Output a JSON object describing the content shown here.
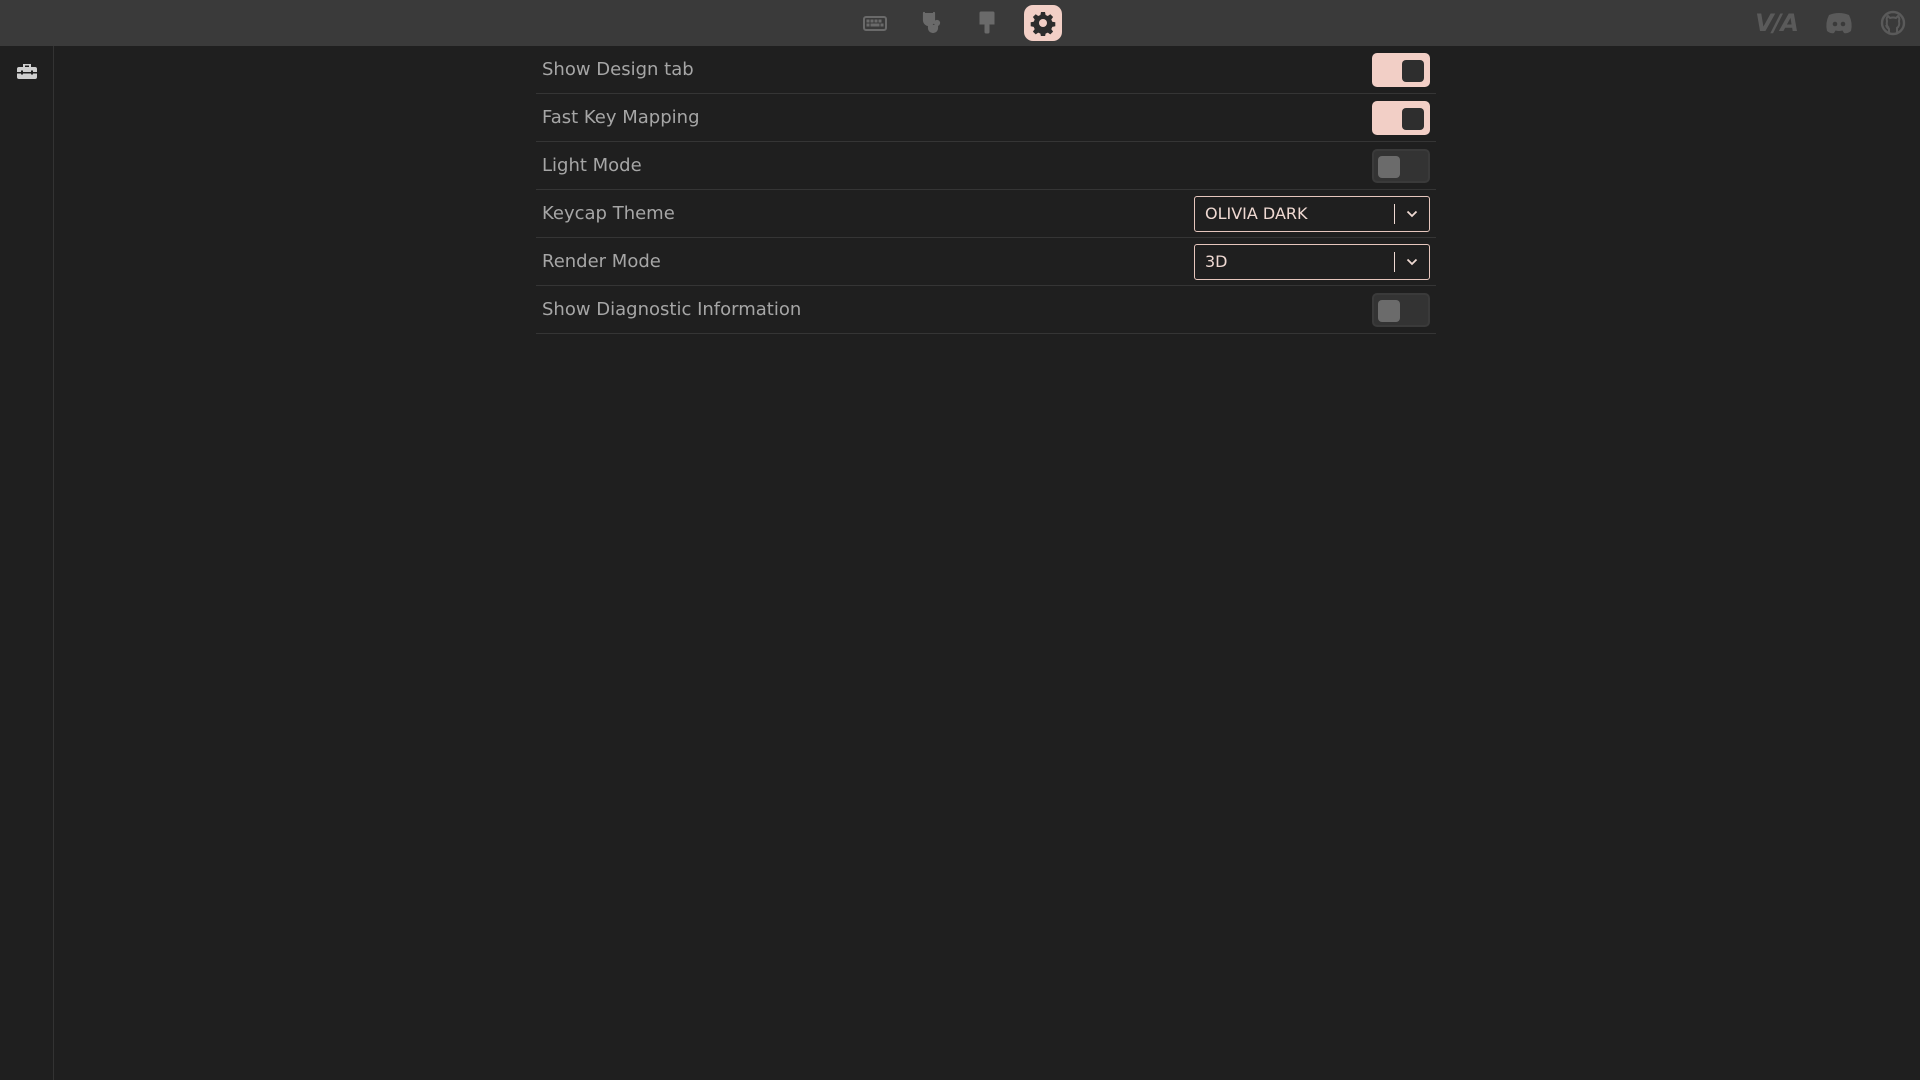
{
  "topbar": {
    "tabs": [
      {
        "icon": "keyboard-icon",
        "active": false
      },
      {
        "icon": "stethoscope-icon",
        "active": false
      },
      {
        "icon": "paintbrush-icon",
        "active": false
      },
      {
        "icon": "gear-icon",
        "active": true
      }
    ],
    "brand": "V/A",
    "right_icons": [
      "via-logo",
      "discord-icon",
      "github-icon"
    ]
  },
  "sidebar": {
    "items": [
      {
        "icon": "toolbox-icon"
      }
    ]
  },
  "settings": {
    "rows": [
      {
        "label": "Show Design tab",
        "control": "toggle",
        "on": true
      },
      {
        "label": "Fast Key Mapping",
        "control": "toggle",
        "on": true
      },
      {
        "label": "Light Mode",
        "control": "toggle",
        "on": false
      },
      {
        "label": "Keycap Theme",
        "control": "select",
        "value": "OLIVIA DARK"
      },
      {
        "label": "Render Mode",
        "control": "select",
        "value": "3D"
      },
      {
        "label": "Show Diagnostic Information",
        "control": "toggle",
        "on": false
      }
    ]
  },
  "colors": {
    "accent": "#f2cfc6",
    "background": "#1f1f1f",
    "topbar": "#3a3a3a"
  }
}
